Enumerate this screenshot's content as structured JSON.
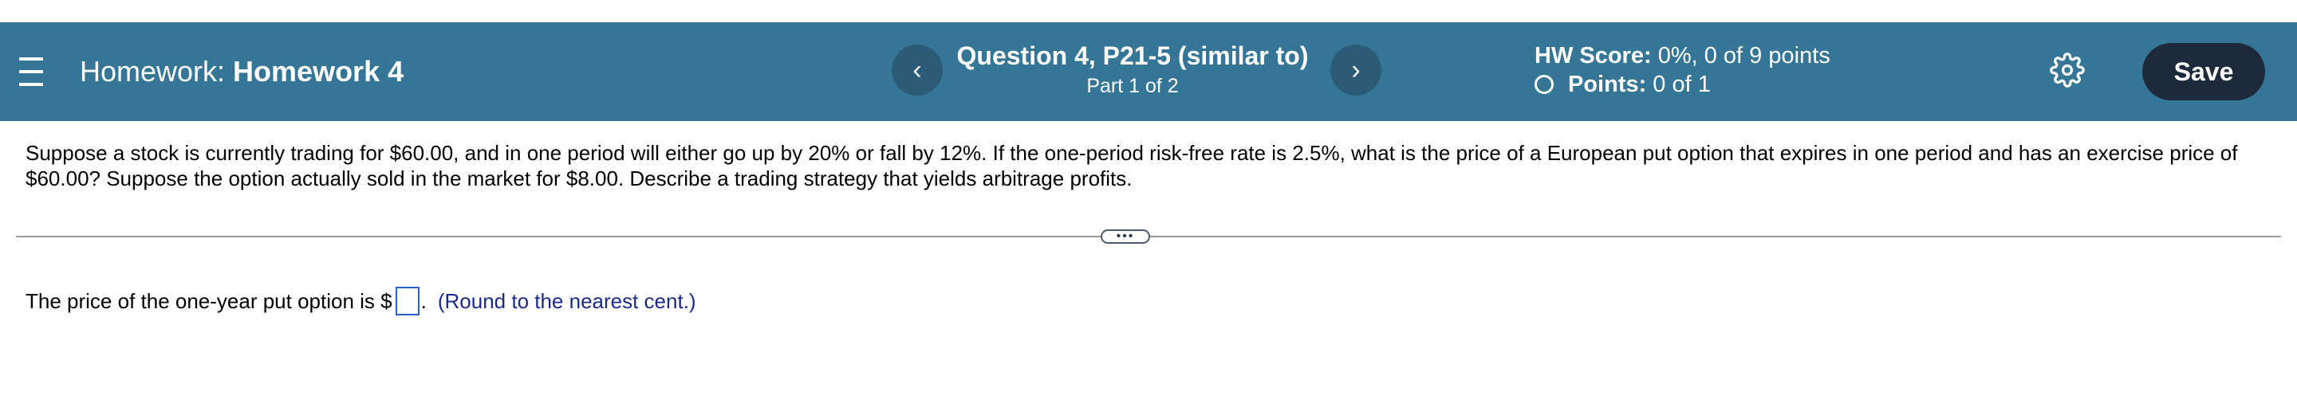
{
  "header": {
    "homework_prefix": "Homework:",
    "homework_name": "Homework 4",
    "prev_symbol": "‹",
    "next_symbol": "›",
    "question_title": "Question 4, P21-5 (similar to)",
    "question_part": "Part 1 of 2",
    "hw_score_label": "HW Score:",
    "hw_score_value": "0%, 0 of 9 points",
    "points_label": "Points:",
    "points_value": "0 of 1",
    "save_label": "Save",
    "menu_icon": "hamburger-menu-icon",
    "settings_icon": "gear-icon"
  },
  "question": {
    "text": "Suppose a stock is currently trading for $60.00, and in one period will either go up by 20% or fall by 12%. If the one-period risk-free rate is 2.5%, what is the price of a European put option that expires in one period and has an exercise price of $60.00? Suppose the option actually sold in the market for $8.00. Describe a trading strategy that yields arbitrage profits.",
    "expand_label": "•••"
  },
  "answer": {
    "prefix": "The price of the one-year put option is $",
    "input_value": "",
    "suffix": ".",
    "hint": "(Round to the nearest cent.)"
  },
  "colors": {
    "header_bg": "#357595",
    "nav_button_bg": "#2c5b77",
    "save_button_bg": "#1c2a3b",
    "hint_text": "#1a2a8a",
    "input_border": "#2e5fc7"
  }
}
